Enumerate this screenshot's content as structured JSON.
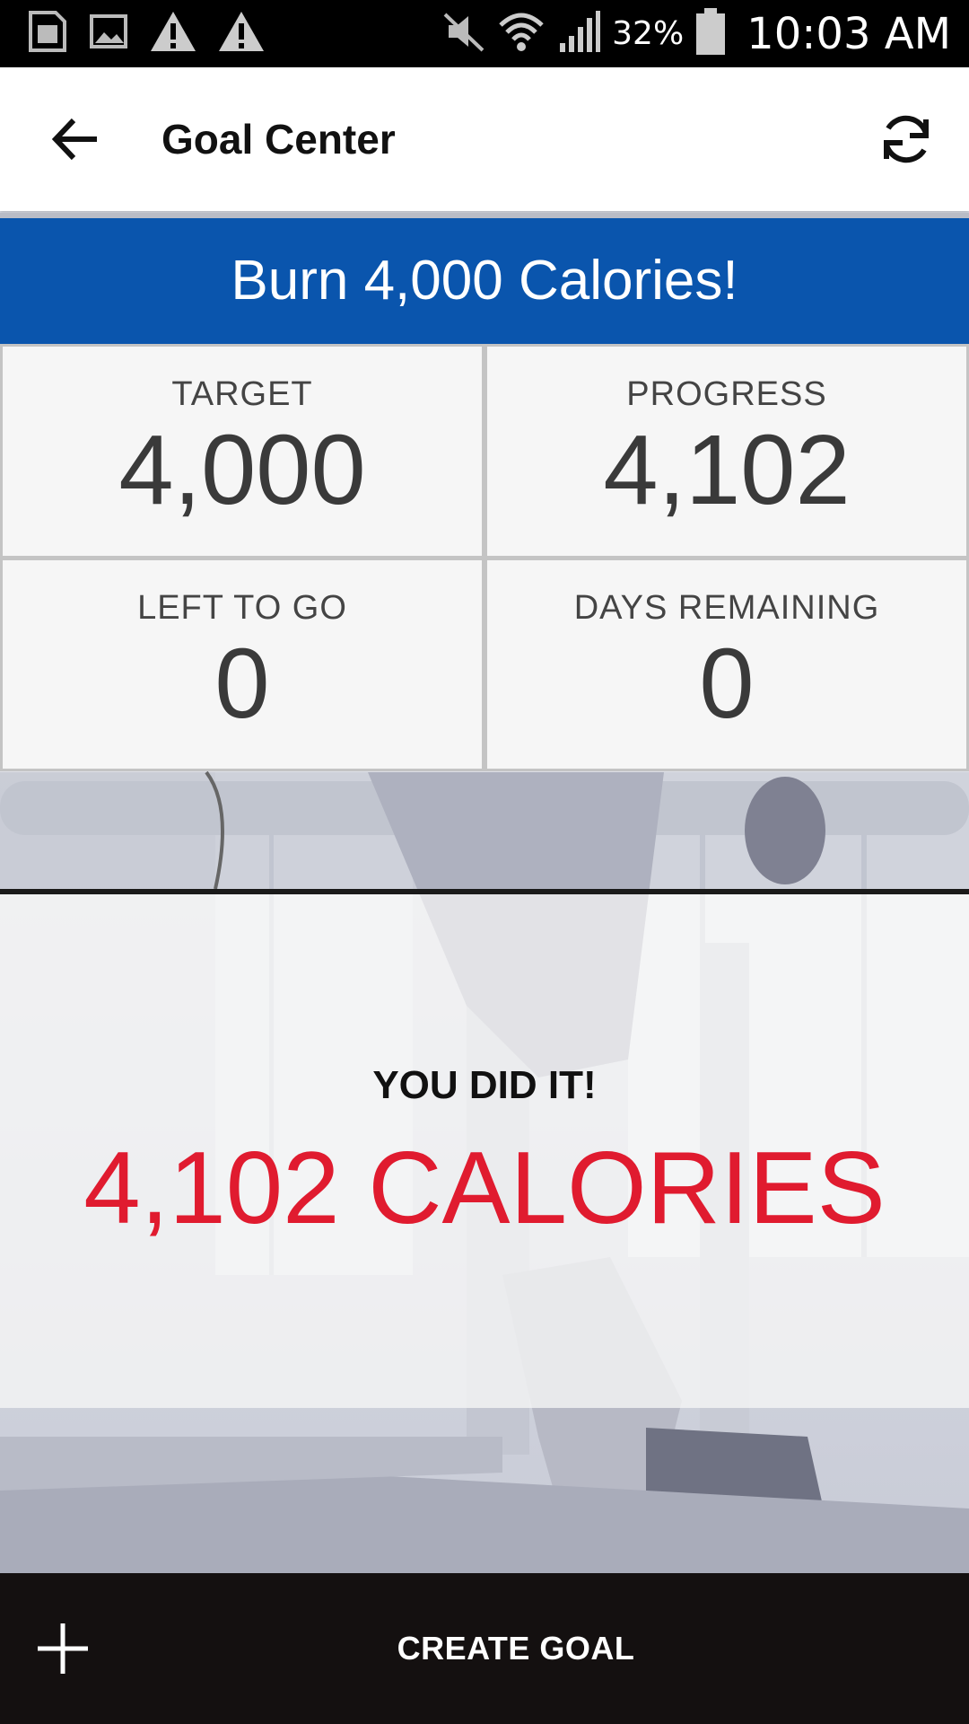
{
  "status_bar": {
    "icons": [
      "sim-card-icon",
      "image-icon",
      "warning-icon",
      "warning-icon",
      "mute-icon",
      "wifi-icon",
      "signal-icon",
      "battery-icon"
    ],
    "battery_pct": "32%",
    "time": "10:03 AM"
  },
  "app_bar": {
    "title": "Goal Center",
    "back_icon": "arrow-back-icon",
    "refresh_icon": "refresh-icon"
  },
  "goal": {
    "banner": "Burn 4,000 Calories!",
    "banner_color": "#0a55ad"
  },
  "stats": [
    {
      "label": "TARGET",
      "value": "4,000"
    },
    {
      "label": "PROGRESS",
      "value": "4,102"
    },
    {
      "label": "LEFT TO GO",
      "value": "0"
    },
    {
      "label": "DAYS REMAINING",
      "value": "0"
    }
  ],
  "celebration": {
    "headline": "YOU DID IT!",
    "result": "4,102 CALORIES",
    "result_color": "#e01b2f"
  },
  "bottom_bar": {
    "add_icon": "plus-icon",
    "create_label": "CREATE GOAL"
  }
}
